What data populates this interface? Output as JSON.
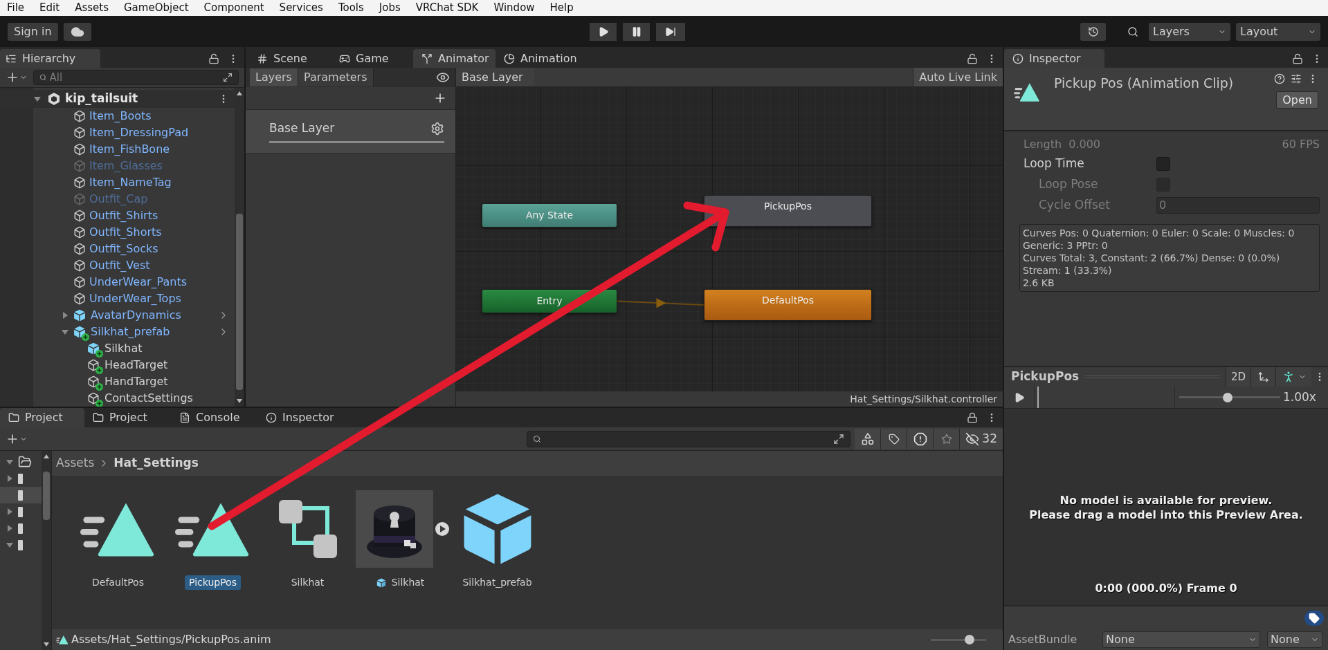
{
  "menu": [
    "File",
    "Edit",
    "Assets",
    "GameObject",
    "Component",
    "Services",
    "Tools",
    "Jobs",
    "VRChat SDK",
    "Window",
    "Help"
  ],
  "toolbar": {
    "sign_in": "Sign in",
    "layers": "Layers",
    "layout": "Layout"
  },
  "hierarchy": {
    "tab": "Hierarchy",
    "search_placeholder": "All",
    "root": {
      "name": "kip_tailsuit",
      "expanded": true,
      "children": [
        {
          "name": "Item_Boots",
          "kind": "object",
          "inactive": false
        },
        {
          "name": "Item_DressingPad",
          "kind": "object",
          "inactive": false
        },
        {
          "name": "Item_FishBone",
          "kind": "object",
          "inactive": false
        },
        {
          "name": "Item_Glasses",
          "kind": "object",
          "inactive": true
        },
        {
          "name": "Item_NameTag",
          "kind": "object",
          "inactive": false
        },
        {
          "name": "Outfit_Cap",
          "kind": "object",
          "inactive": true
        },
        {
          "name": "Outfit_Shirts",
          "kind": "object",
          "inactive": false
        },
        {
          "name": "Outfit_Shorts",
          "kind": "object",
          "inactive": false
        },
        {
          "name": "Outfit_Socks",
          "kind": "object",
          "inactive": false
        },
        {
          "name": "Outfit_Vest",
          "kind": "object",
          "inactive": false
        },
        {
          "name": "UnderWear_Pants",
          "kind": "object",
          "inactive": false
        },
        {
          "name": "UnderWear_Tops",
          "kind": "object",
          "inactive": false
        },
        {
          "name": "AvatarDynamics",
          "kind": "prefab",
          "inactive": false,
          "expanded": false
        },
        {
          "name": "Silkhat_prefab",
          "kind": "prefab_added",
          "inactive": false,
          "expanded": true,
          "children": [
            {
              "name": "Silkhat",
              "kind": "added_prefab",
              "inactive": false
            },
            {
              "name": "HeadTarget",
              "kind": "added",
              "inactive": false
            },
            {
              "name": "HandTarget",
              "kind": "added",
              "inactive": false
            },
            {
              "name": "ContactSettings",
              "kind": "added",
              "inactive": false
            }
          ]
        }
      ]
    }
  },
  "animator": {
    "tabs": [
      {
        "label": "Scene",
        "kind": "scene",
        "selected": false
      },
      {
        "label": "Game",
        "kind": "game",
        "selected": false
      },
      {
        "label": "Animator",
        "kind": "animator",
        "selected": true
      },
      {
        "label": "Animation",
        "kind": "animation",
        "selected": false
      }
    ],
    "layer_tabs": [
      {
        "label": "Layers",
        "selected": true
      },
      {
        "label": "Parameters",
        "selected": false
      }
    ],
    "breadcrumb": "Base Layer",
    "live_link": "Auto Live Link",
    "layers": [
      {
        "name": "Base Layer"
      }
    ],
    "nodes": [
      {
        "label": "Any State",
        "kind": "any"
      },
      {
        "label": "Entry",
        "kind": "entry"
      },
      {
        "label": "PickupPos",
        "kind": "state"
      },
      {
        "label": "DefaultPos",
        "kind": "default"
      }
    ],
    "footer": "Hat_Settings/Silkhat.controller"
  },
  "project": {
    "tabs": [
      {
        "label": "Project",
        "kind": "folder",
        "selected": true
      },
      {
        "label": "Project",
        "kind": "folder",
        "selected": false
      },
      {
        "label": "Console",
        "kind": "console",
        "selected": false
      },
      {
        "label": "Inspector",
        "kind": "info",
        "selected": false
      }
    ],
    "hidden_count": "32",
    "folder_tree": [
      {
        "expanded": true,
        "selected": false
      },
      {
        "expanded": false,
        "selected": false
      },
      {
        "selected": true
      },
      {
        "expanded": false,
        "selected": false
      },
      {
        "expanded": false,
        "selected": false
      },
      {
        "expanded": true,
        "selected": false
      }
    ],
    "breadcrumb": [
      "Assets",
      "Hat_Settings"
    ],
    "assets": [
      {
        "name": "DefaultPos",
        "kind": "anim",
        "selected": false
      },
      {
        "name": "PickupPos",
        "kind": "anim",
        "selected": true
      },
      {
        "name": "Silkhat",
        "kind": "controller",
        "selected": false
      },
      {
        "name": "Silkhat",
        "kind": "model",
        "selected": false
      },
      {
        "name": "Silkhat_prefab",
        "kind": "prefab",
        "selected": false
      }
    ],
    "path": "Assets/Hat_Settings/PickupPos.anim",
    "icon_size": {
      "level": 0.74
    }
  },
  "inspector": {
    "tab": "Inspector",
    "title": "Pickup Pos (Animation Clip)",
    "open": "Open",
    "length_label": "Length",
    "length": "0.000",
    "fps": "60 FPS",
    "fields": [
      {
        "label": "Loop Time",
        "kind": "checkbox",
        "checked": false,
        "disabled": false
      },
      {
        "label": "Loop Pose",
        "kind": "checkbox",
        "checked": false,
        "disabled": true
      },
      {
        "label": "Cycle Offset",
        "kind": "number",
        "value": "0",
        "disabled": true
      }
    ],
    "info": [
      "Curves Pos: 0 Quaternion: 0 Euler: 0 Scale: 0 Muscles: 0",
      "Generic: 3 PPtr: 0",
      "Curves Total: 3, Constant: 2 (66.7%) Dense: 0 (0.0%)",
      "Stream: 1 (33.3%)",
      "2.6 KB"
    ],
    "preview": {
      "title": "PickupPos",
      "mode": "2D",
      "speed": {
        "level": 0.48,
        "reading": "1.00x"
      },
      "message": [
        "No model is available for preview.",
        "Please drag a model into this Preview Area."
      ],
      "frame": "0:00 (000.0%) Frame 0"
    },
    "asset_bundle": {
      "label": "AssetBundle",
      "name": "None",
      "variant": "None"
    }
  }
}
